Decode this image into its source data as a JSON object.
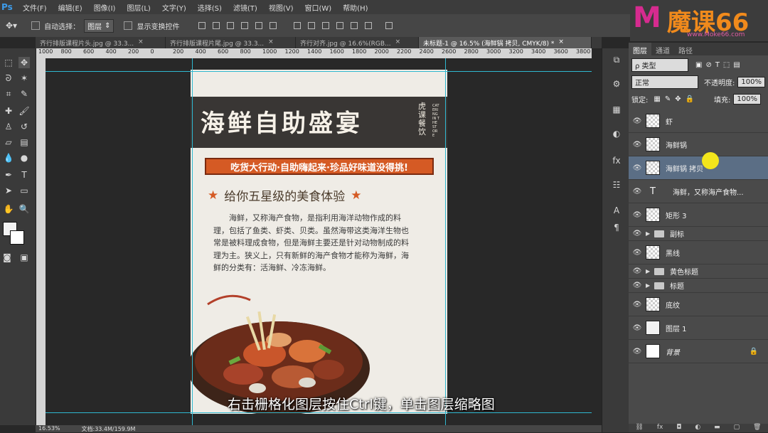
{
  "app": {
    "logo": "Ps"
  },
  "menu": [
    "文件(F)",
    "编辑(E)",
    "图像(I)",
    "图层(L)",
    "文字(Y)",
    "选择(S)",
    "滤镜(T)",
    "视图(V)",
    "窗口(W)",
    "帮助(H)"
  ],
  "options": {
    "auto_select_label": "自动选择：",
    "auto_select_value": "图层",
    "transform_label": "显示变换控件"
  },
  "tabs": [
    {
      "label": "齐行排版课程片头.jpg @ 33.3...",
      "close": "×"
    },
    {
      "label": "齐行排版课程片尾.jpg @ 33.3...",
      "close": "×"
    },
    {
      "label": "齐行对齐.jpg @ 16.6%(RGB...",
      "close": "×"
    },
    {
      "label": "未标题-1 @ 16.5% (海鲜锅 拷贝, CMYK/8) *",
      "close": "×"
    }
  ],
  "ruler_ticks": [
    "1000",
    "800",
    "600",
    "400",
    "200",
    "0",
    "200",
    "400",
    "600",
    "800",
    "1000",
    "1200",
    "1400",
    "1600",
    "1800",
    "2000",
    "2200",
    "2400",
    "2600",
    "2800",
    "3000",
    "3200",
    "3400",
    "3600",
    "3800"
  ],
  "poster": {
    "title": "海鲜自助盛宴",
    "side_cn": "虎课餐饮",
    "side_en": "CATERING IN THE STORE",
    "banner": "吃货大行动·自助嗨起来·珍品好味道没得挑!",
    "subtitle": "给你五星级的美食体验",
    "body": "海鲜，又称海产食物，是指利用海洋动物作成的料理，包括了鱼类、虾类、贝类。虽然海带这类海洋生物也常是被料理成食物，但是海鲜主要还是针对动物制成的料理为主。狭义上，只有新鲜的海产食物才能称为海鲜，海鲜的分类有：活海鲜、冷冻海鲜。"
  },
  "caption": "右击栅格化图层按住Ctrl键，单击图层缩略图",
  "status": {
    "zoom": "16.53%",
    "doc": "文档:33.4M/159.9M"
  },
  "panel": {
    "tabs": [
      "图层",
      "通道",
      "路径"
    ],
    "filter_label": "ρ 类型",
    "blend_mode": "正常",
    "opacity_label": "不透明度:",
    "opacity_value": "100%",
    "lock_label": "锁定:",
    "fill_label": "填充:",
    "fill_value": "100%"
  },
  "layers": [
    {
      "name": "虾",
      "kind": "smart",
      "selected": false
    },
    {
      "name": "海鲜锅",
      "kind": "smart",
      "selected": false
    },
    {
      "name": "海鲜锅 拷贝",
      "kind": "smart",
      "selected": true
    },
    {
      "name": "海鲜，又称海产食物...",
      "kind": "text",
      "selected": false
    },
    {
      "name": "矩形 3",
      "kind": "shape",
      "selected": false
    },
    {
      "name": "副标",
      "kind": "group",
      "selected": false
    },
    {
      "name": "黑线",
      "kind": "shape",
      "selected": false
    },
    {
      "name": "黄色标题",
      "kind": "group",
      "selected": false
    },
    {
      "name": "标题",
      "kind": "group",
      "selected": false
    },
    {
      "name": "底纹",
      "kind": "smart",
      "selected": false
    },
    {
      "name": "图层 1",
      "kind": "plain",
      "selected": false
    },
    {
      "name": "背景",
      "kind": "background",
      "selected": false
    }
  ],
  "watermark": {
    "logo": "M",
    "name": "魔课66",
    "url": "www.Moke66.com"
  }
}
